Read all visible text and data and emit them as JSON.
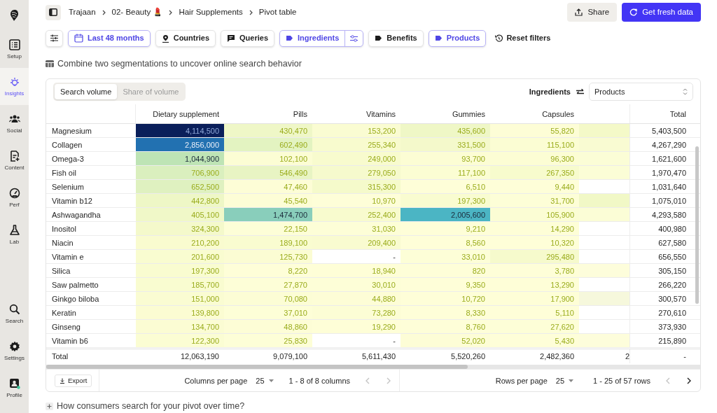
{
  "sidebar": {
    "items": [
      {
        "label": "Setup",
        "selected": false
      },
      {
        "label": "Insights",
        "selected": true
      },
      {
        "label": "Social",
        "selected": false
      },
      {
        "label": "Content",
        "selected": false
      },
      {
        "label": "Perf",
        "selected": false
      },
      {
        "label": "Lab",
        "selected": false
      }
    ],
    "bottom_items": [
      {
        "label": "Search",
        "selected": false
      },
      {
        "label": "Settings",
        "selected": false
      },
      {
        "label": "Profile",
        "selected": false
      }
    ]
  },
  "breadcrumb": [
    "Trajaan",
    "02- Beauty 💄",
    "Hair Supplements",
    "Pivot table"
  ],
  "actions": [
    {
      "label": "Share",
      "kind": "secondary"
    },
    {
      "label": "Get fresh data",
      "kind": "primary"
    }
  ],
  "filters": [
    {
      "label": "Last 48 months",
      "kind": "period",
      "selected": true
    },
    {
      "label": "Countries",
      "kind": "place",
      "selected": false
    },
    {
      "label": "Queries",
      "kind": "query",
      "selected": false
    },
    {
      "label": "Ingredients",
      "kind": "category",
      "selected": true,
      "has_settings": true
    },
    {
      "label": "Benefits",
      "kind": "category",
      "selected": false
    },
    {
      "label": "Products",
      "kind": "category",
      "selected": true
    }
  ],
  "reset_label": "Reset filters",
  "section_title": "Combine two segmentations to uncover online search behavior",
  "view_tabs": [
    {
      "label": "Search volume",
      "selected": true
    },
    {
      "label": "Share of volume",
      "selected": false
    }
  ],
  "pivot": {
    "rows_label": "Ingredients",
    "columns_select": "Products"
  },
  "table": {
    "columns": [
      "Dietary supplement",
      "Pills",
      "Vitamins",
      "Gummies",
      "Capsules"
    ],
    "total_column": "Total",
    "rows": [
      {
        "label": "Magnesium",
        "cells": [
          "4,114,500",
          "430,470",
          "153,200",
          "435,600",
          "55,820"
        ],
        "color": "#f4f9c8",
        "total": "5,403,500"
      },
      {
        "label": "Collagen",
        "cells": [
          "2,856,000",
          "602,490",
          "255,340",
          "331,500",
          "115,100"
        ],
        "color": "#f9fbd2",
        "total": "4,267,290"
      },
      {
        "label": "Omega-3",
        "cells": [
          "1,044,900",
          "102,100",
          "249,000",
          "93,700",
          "96,300"
        ],
        "color": "#fbfdd6",
        "total": "1,621,600"
      },
      {
        "label": "Fish oil",
        "cells": [
          "706,900",
          "546,490",
          "279,050",
          "117,100",
          "267,350"
        ],
        "color": "#fbfdd6",
        "total": "1,970,470"
      },
      {
        "label": "Selenium",
        "cells": [
          "652,500",
          "47,460",
          "315,300",
          "6,510",
          "9,440"
        ],
        "color": null,
        "total": "1,031,640"
      },
      {
        "label": "Vitamin b12",
        "cells": [
          "442,800",
          "45,540",
          "10,970",
          "197,300",
          "31,700"
        ],
        "color": "#f1f8c6",
        "total": "1,075,010"
      },
      {
        "label": "Ashwagandha",
        "cells": [
          "405,100",
          "1,474,700",
          "252,400",
          "2,005,600",
          "105,900"
        ],
        "color": "#fbfdd6",
        "total": "4,293,580"
      },
      {
        "label": "Inositol",
        "cells": [
          "324,300",
          "22,150",
          "31,030",
          "9,210",
          "14,290"
        ],
        "color": null,
        "total": "400,980"
      },
      {
        "label": "Niacin",
        "cells": [
          "210,200",
          "189,100",
          "209,400",
          "8,560",
          "10,320"
        ],
        "color": null,
        "total": "627,580"
      },
      {
        "label": "Vitamin e",
        "cells": [
          "201,600",
          "125,730",
          "-",
          "33,010",
          "295,480"
        ],
        "color": null,
        "total": "656,550"
      },
      {
        "label": "Silica",
        "cells": [
          "197,300",
          "8,220",
          "18,940",
          "820",
          "3,780"
        ],
        "color": "#fdfddb",
        "total": "305,150"
      },
      {
        "label": "Saw palmetto",
        "cells": [
          "185,700",
          "27,870",
          "30,010",
          "9,350",
          "13,290"
        ],
        "color": null,
        "total": "266,220"
      },
      {
        "label": "Ginkgo biloba",
        "cells": [
          "151,000",
          "70,080",
          "44,880",
          "10,720",
          "17,900"
        ],
        "color": "#f6f8dc",
        "total": "300,570"
      },
      {
        "label": "Keratin",
        "cells": [
          "139,800",
          "37,010",
          "73,280",
          "8,330",
          "5,110"
        ],
        "color": null,
        "total": "270,610"
      },
      {
        "label": "Ginseng",
        "cells": [
          "134,700",
          "48,860",
          "19,290",
          "8,760",
          "27,620"
        ],
        "color": null,
        "total": "373,930"
      },
      {
        "label": "Vitamin b6",
        "cells": [
          "122,300",
          "25,830",
          "-",
          "52,020",
          "5,430"
        ],
        "color": "#fdfddb",
        "total": "215,890"
      }
    ],
    "totals": {
      "label": "Total",
      "cells": [
        "12,063,190",
        "9,079,100",
        "5,611,430",
        "5,520,260",
        "2,482,360"
      ],
      "cut_cell": "2",
      "total": "-"
    }
  },
  "footer": {
    "export": "Export",
    "columns_per_page_label": "Columns per page",
    "columns_per_page": "25",
    "columns_range": "1 - 8 of 8 columns",
    "rows_per_page_label": "Rows per page",
    "rows_per_page": "25",
    "rows_range": "1 - 25 of 57 rows"
  },
  "next_section_title": "How consumers search for your pivot over time?"
}
